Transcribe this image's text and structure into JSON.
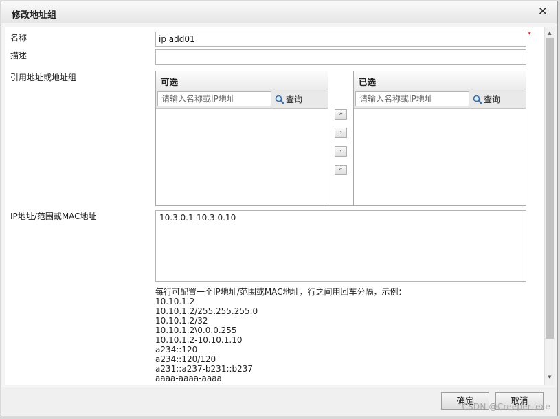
{
  "dialog": {
    "title": "修改地址组"
  },
  "form": {
    "name_label": "名称",
    "name_value": "ip add01",
    "required_mark": "*",
    "desc_label": "描述",
    "desc_value": "",
    "ref_label": "引用地址或地址组",
    "ip_label": "IP地址/范围或MAC地址"
  },
  "available": {
    "title": "可选",
    "search_placeholder": "请输入名称或IP地址",
    "search_button": "查询"
  },
  "selected": {
    "title": "已选",
    "search_placeholder": "请输入名称或IP地址",
    "search_button": "查询"
  },
  "transfer": {
    "add_all": "»",
    "add": "›",
    "remove": "‹",
    "remove_all": "«"
  },
  "ip_text": "10.3.0.1-10.3.0.10",
  "hint": {
    "intro": "每行可配置一个IP地址/范围或MAC地址，行之间用回车分隔，示例：",
    "examples": [
      "10.10.1.2",
      "10.10.1.2/255.255.255.0",
      "10.10.1.2/32",
      "10.10.1.2\\0.0.0.255",
      "10.10.1.2-10.10.1.10",
      "a234::120",
      "a234::120/120",
      "a231::a237-b231::b237",
      "aaaa-aaaa-aaaa"
    ]
  },
  "footer": {
    "ok": "确定",
    "cancel": "取消"
  },
  "watermark": "CSDN @Creeper_exe",
  "icons": {
    "close": "close-icon",
    "search": "search-icon"
  }
}
